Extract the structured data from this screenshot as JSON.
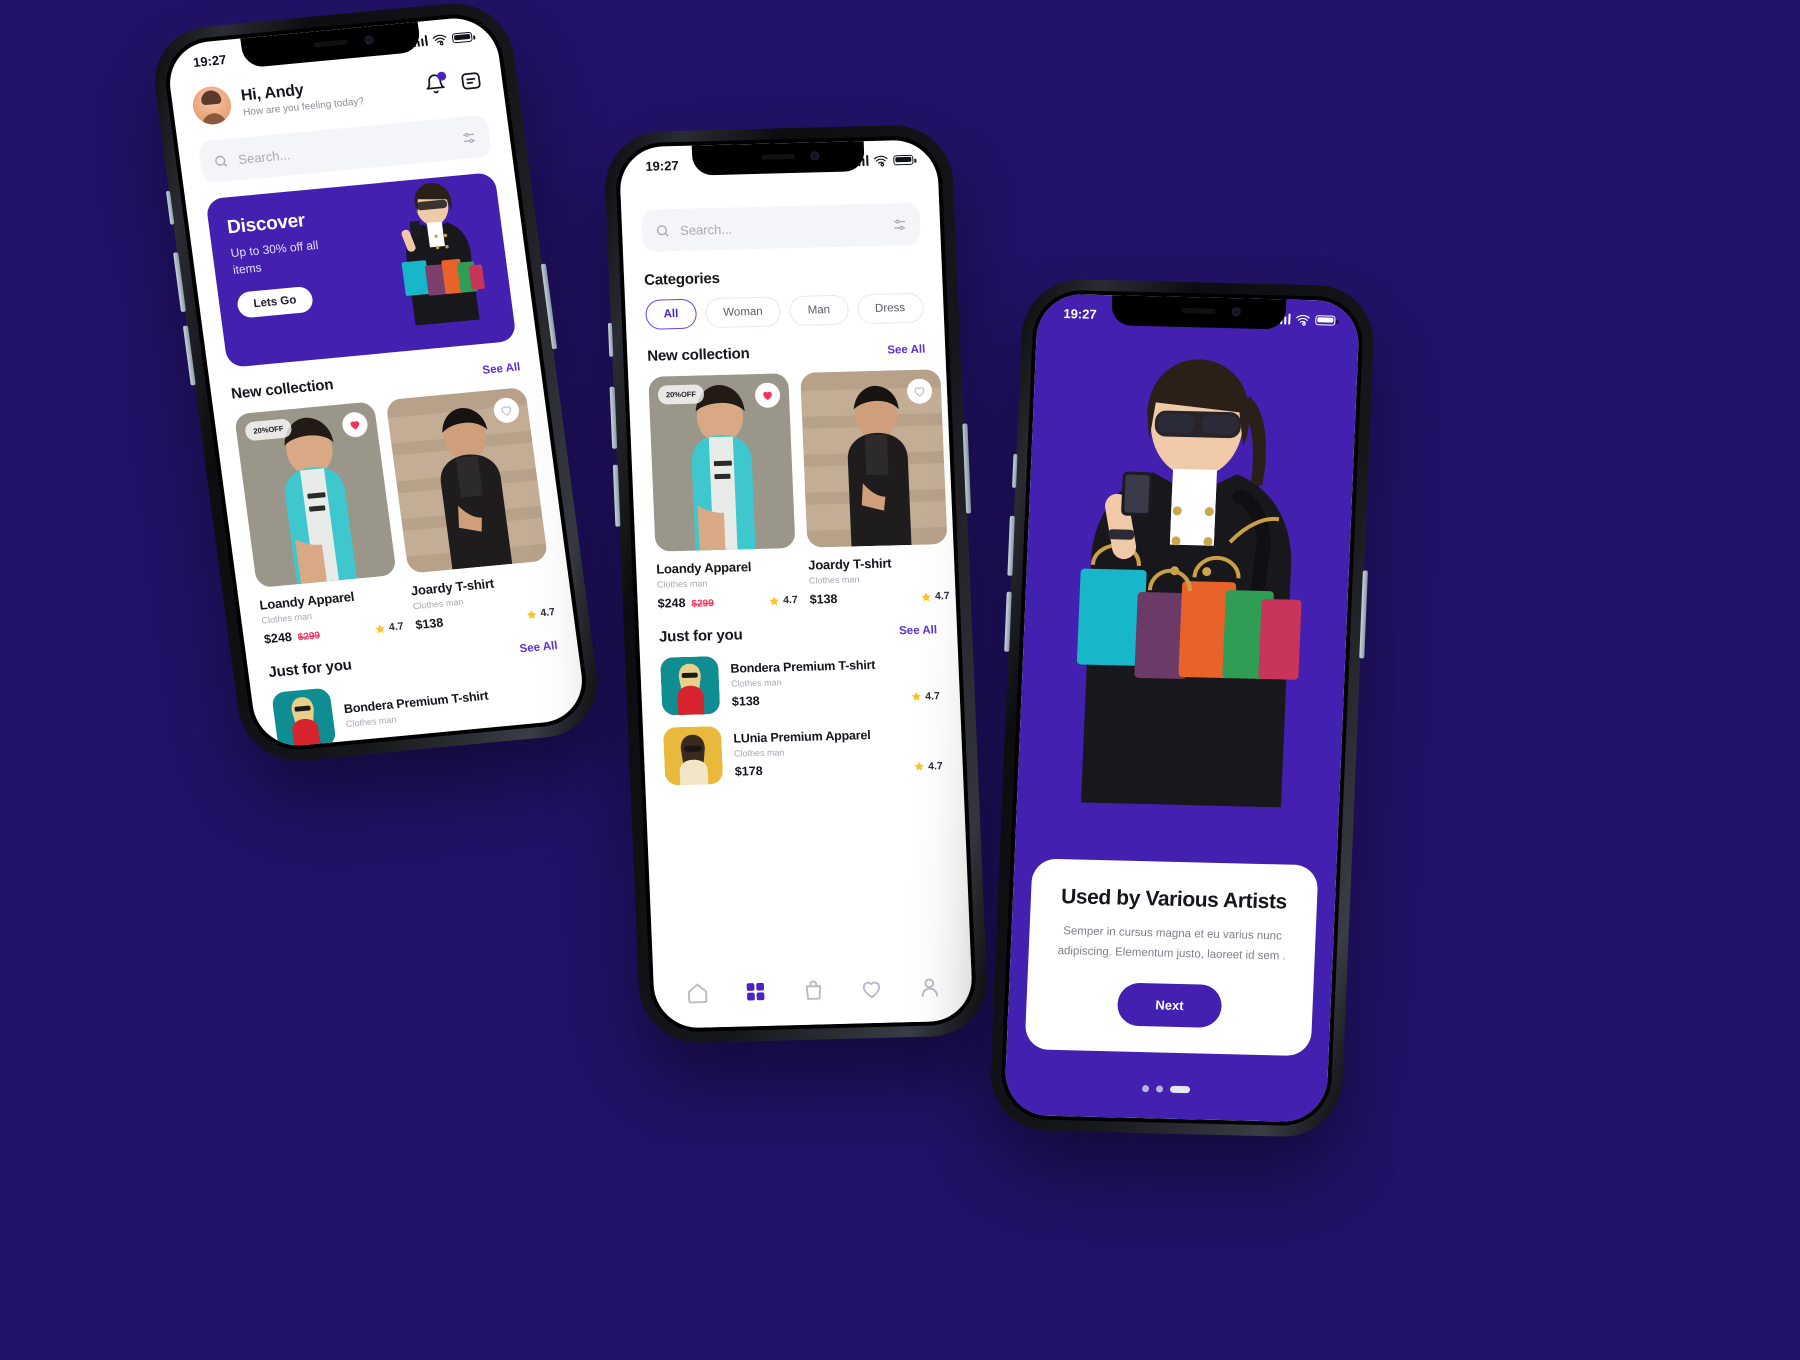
{
  "theme": {
    "background": "#221268",
    "accent": "#4320b0",
    "accent_light": "#5b2fd6",
    "sale_red": "#f3335c",
    "star_yellow": "#ffc327"
  },
  "status_bar": {
    "time": "19:27",
    "signal_icon": "signal-bars-icon",
    "wifi_icon": "wifi-icon",
    "battery_icon": "battery-icon"
  },
  "home": {
    "greeting": {
      "name": "Hi, Andy",
      "subtitle": "How are you feeling today?",
      "avatar_icon": "avatar"
    },
    "header_icons": [
      {
        "name": "notification-bell-icon",
        "label": "Notifications"
      },
      {
        "name": "message-icon",
        "label": "Messages"
      }
    ],
    "search": {
      "placeholder": "Search...",
      "value": "",
      "search_icon": "search-icon",
      "filter_icon": "filter-sliders-icon"
    },
    "banner": {
      "title": "Discover",
      "subtitle": "Up to 30% off all items",
      "cta": "Lets Go"
    },
    "new_collection": {
      "title": "New collection",
      "see_all": "See All",
      "products": [
        {
          "name": "Loandy Apparel",
          "category": "Clothes man",
          "price": "$248",
          "old_price": "$299",
          "rating": "4.7",
          "badge": "20%",
          "badge_suffix": "OFF",
          "favorited": true
        },
        {
          "name": "Joardy T-shirt",
          "category": "Clothes man",
          "price": "$138",
          "old_price": "",
          "rating": "4.7",
          "badge": "",
          "badge_suffix": "",
          "favorited": false
        }
      ]
    },
    "just_for_you": {
      "title": "Just for you",
      "see_all": "See All",
      "products": [
        {
          "name": "Bondera Premium T-shirt",
          "category": "Clothes man",
          "price": "$138",
          "rating": "4.7"
        },
        {
          "name": "LUnia Premium Apparel",
          "category": "Clothes man",
          "price": "$178",
          "rating": "4.7"
        }
      ]
    }
  },
  "catalog": {
    "search": {
      "placeholder": "Search...",
      "value": ""
    },
    "categories": {
      "title": "Categories",
      "chips": [
        {
          "label": "All",
          "active": true
        },
        {
          "label": "Woman",
          "active": false
        },
        {
          "label": "Man",
          "active": false
        },
        {
          "label": "Dress",
          "active": false
        }
      ]
    },
    "tabbar": [
      {
        "name": "nav-home",
        "icon": "home-icon",
        "active": false
      },
      {
        "name": "nav-categories",
        "icon": "grid-icon",
        "active": true
      },
      {
        "name": "nav-bag",
        "icon": "shopping-bag-icon",
        "active": false
      },
      {
        "name": "nav-wishlist",
        "icon": "heart-icon",
        "active": false
      },
      {
        "name": "nav-profile",
        "icon": "person-icon",
        "active": false
      }
    ]
  },
  "onboarding": {
    "title": "Used by Various Artists",
    "body": "Semper in cursus magna et eu varius nunc adipiscing. Elementum justo, laoreet id sem .",
    "next": "Next",
    "page_dots": 3,
    "active_dot": 3
  }
}
